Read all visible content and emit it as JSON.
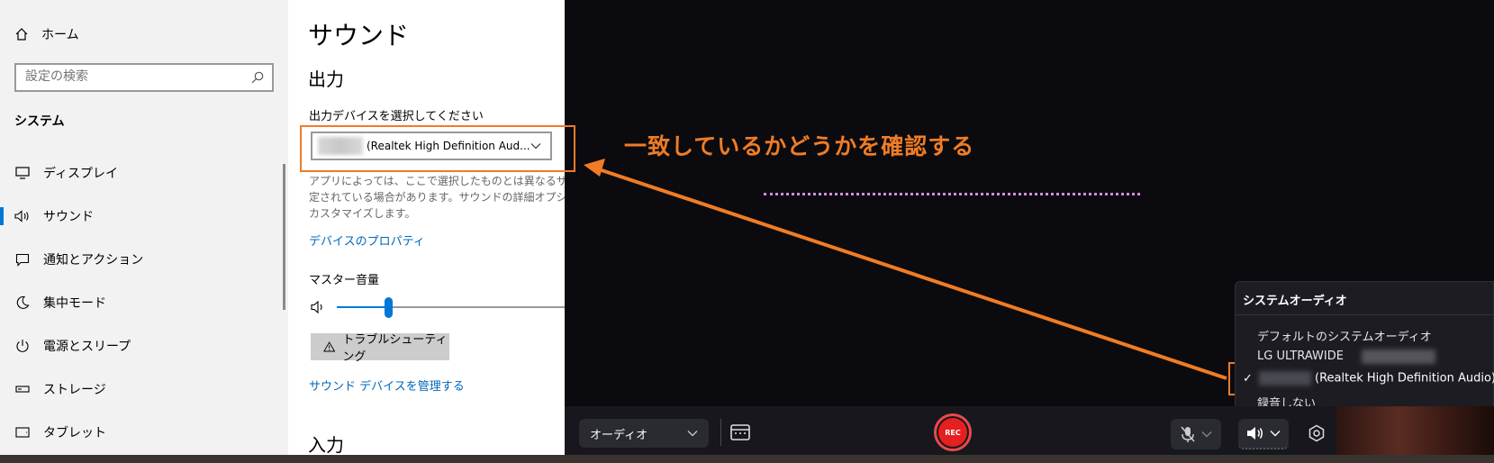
{
  "settings_nav": {
    "home_label": "ホーム",
    "search_placeholder": "設定の検索",
    "section_label": "システム",
    "items": [
      {
        "label": "ディスプレイ",
        "icon": "display-icon"
      },
      {
        "label": "サウンド",
        "icon": "speaker-icon",
        "active": true
      },
      {
        "label": "通知とアクション",
        "icon": "notification-icon"
      },
      {
        "label": "集中モード",
        "icon": "moon-icon"
      },
      {
        "label": "電源とスリープ",
        "icon": "power-icon"
      },
      {
        "label": "ストレージ",
        "icon": "storage-icon"
      },
      {
        "label": "タブレット",
        "icon": "tablet-icon"
      }
    ]
  },
  "sound_page": {
    "title": "サウンド",
    "output_heading": "出力",
    "choose_device_label": "出力デバイスを選択してください",
    "output_device_value": "(Realtek High Definition Aud...",
    "description_lines": [
      "アプリによっては、ここで選択したものとは異なるサウン",
      "定されている場合があります。サウンドの詳細オプショ",
      "カスタマイズします。"
    ],
    "device_properties_link": "デバイスのプロパティ",
    "master_volume_label": "マスター音量",
    "master_volume_level": 0.21,
    "troubleshoot_button": "トラブルシューティング",
    "manage_devices_link": "サウンド デバイスを管理する",
    "input_heading": "入力"
  },
  "annotation": {
    "text": "一致しているかどうかを確認する",
    "color": "#f07c25"
  },
  "toolbar": {
    "audio_select_value": "オーディオ",
    "rec_label": "REC"
  },
  "system_audio_popup": {
    "title": "システムオーディオ",
    "items": [
      {
        "label": "デフォルトのシステムオーディオ",
        "selected": false
      },
      {
        "label": "LG ULTRAWIDE",
        "selected": false
      },
      {
        "label": "(Realtek High Definition Audio)",
        "selected": true
      },
      {
        "label": "録音しない",
        "selected": false
      }
    ],
    "checkmark": "✓"
  },
  "colors": {
    "accent_blue": "#0078d7",
    "link_blue": "#0067b8",
    "rec_red": "#e61f1f",
    "highlight_orange": "#ef7b29"
  }
}
